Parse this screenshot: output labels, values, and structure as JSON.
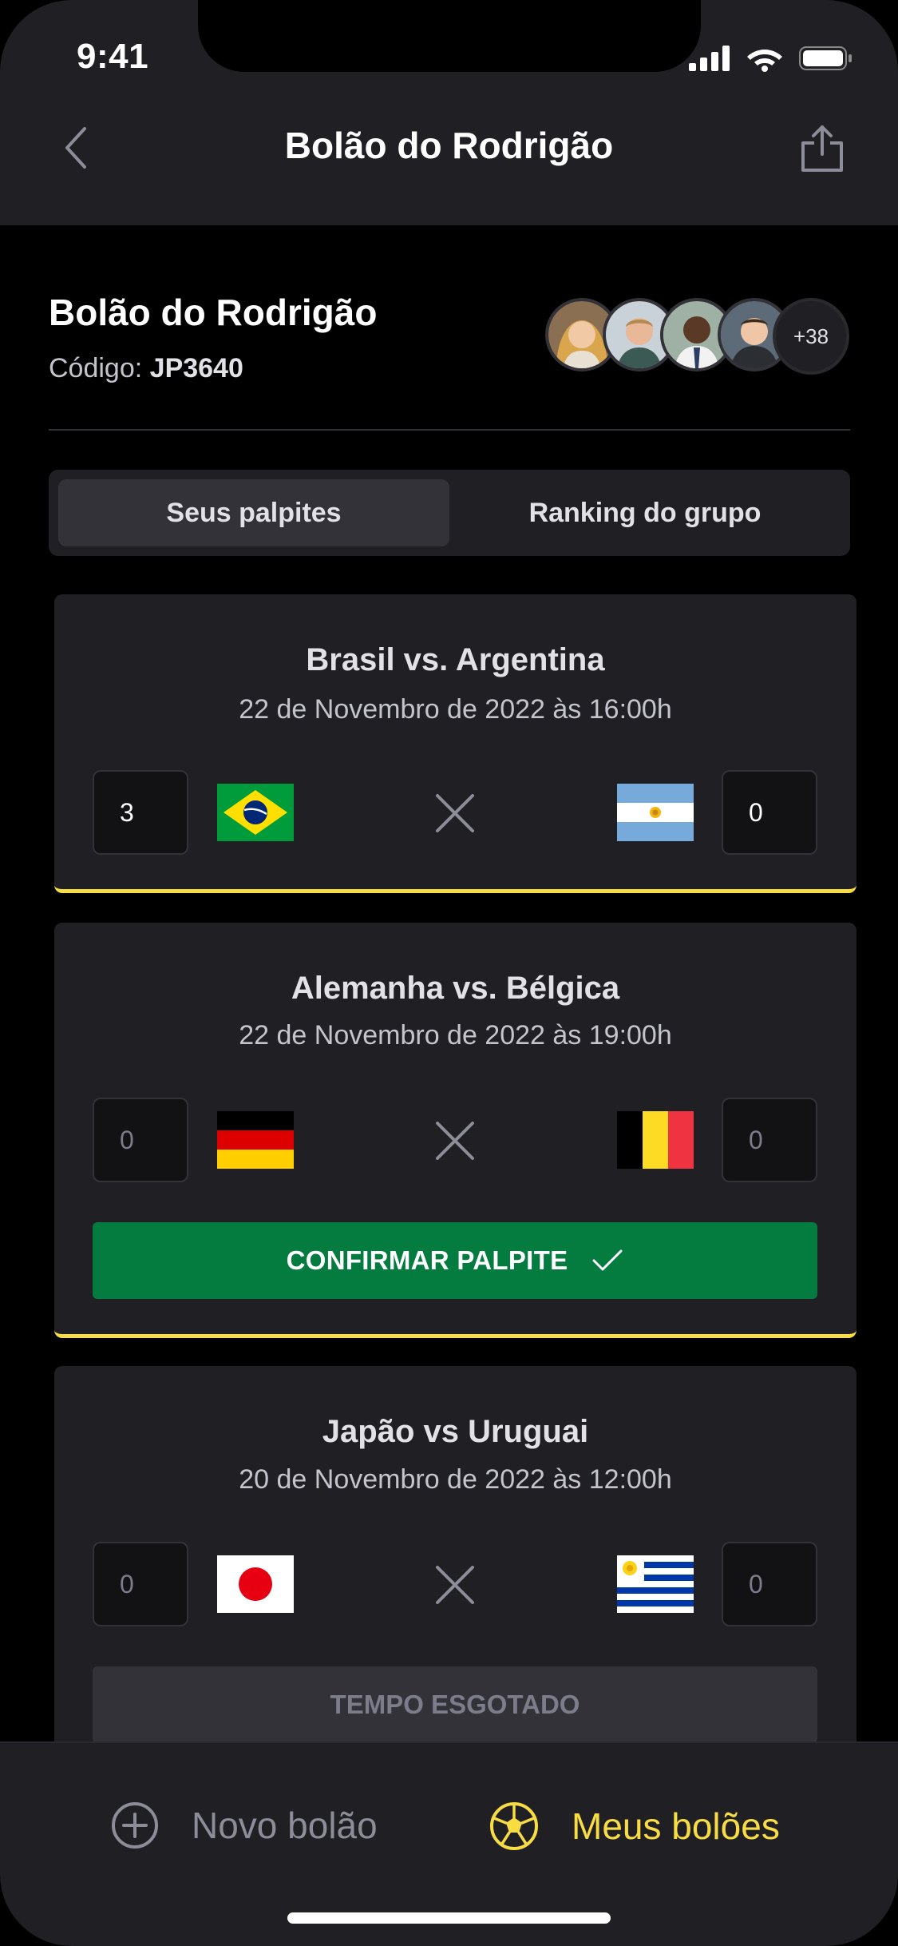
{
  "status_bar": {
    "time": "9:41"
  },
  "header": {
    "title": "Bolão do Rodrigão"
  },
  "group": {
    "name": "Bolão do Rodrigão",
    "code_label": "Código:",
    "code_value": "JP3640",
    "extra_members": "+38"
  },
  "tabs": [
    {
      "label": "Seus palpites",
      "active": true
    },
    {
      "label": "Ranking do grupo",
      "active": false
    }
  ],
  "matches": [
    {
      "title": "Brasil vs. Argentina",
      "date": "22 de Novembro de 2022 às 16:00h",
      "home_score": "3",
      "away_score": "0",
      "home_flag": "brazil-flag-icon",
      "away_flag": "argentina-flag-icon"
    },
    {
      "title": "Alemanha vs. Bélgica",
      "date": "22 de Novembro de 2022 às 19:00h",
      "home_score": "0",
      "away_score": "0",
      "home_flag": "germany-flag-icon",
      "away_flag": "belgium-flag-icon",
      "action_label": "CONFIRMAR PALPITE"
    },
    {
      "title": "Japão vs Uruguai",
      "date": "20 de Novembro de 2022 às 12:00h",
      "home_score": "0",
      "away_score": "0",
      "home_flag": "japan-flag-icon",
      "away_flag": "uruguay-flag-icon",
      "action_label": "TEMPO ESGOTADO"
    }
  ],
  "bottom_nav": [
    {
      "label": "Novo bolão",
      "icon": "plus-circle-icon",
      "active": false
    },
    {
      "label": "Meus bolões",
      "icon": "soccer-ball-icon",
      "active": true
    }
  ],
  "colors": {
    "background": "#000000",
    "surface": "#202024",
    "accent_yellow": "#F7DD43",
    "confirm_green": "#047C3F"
  }
}
